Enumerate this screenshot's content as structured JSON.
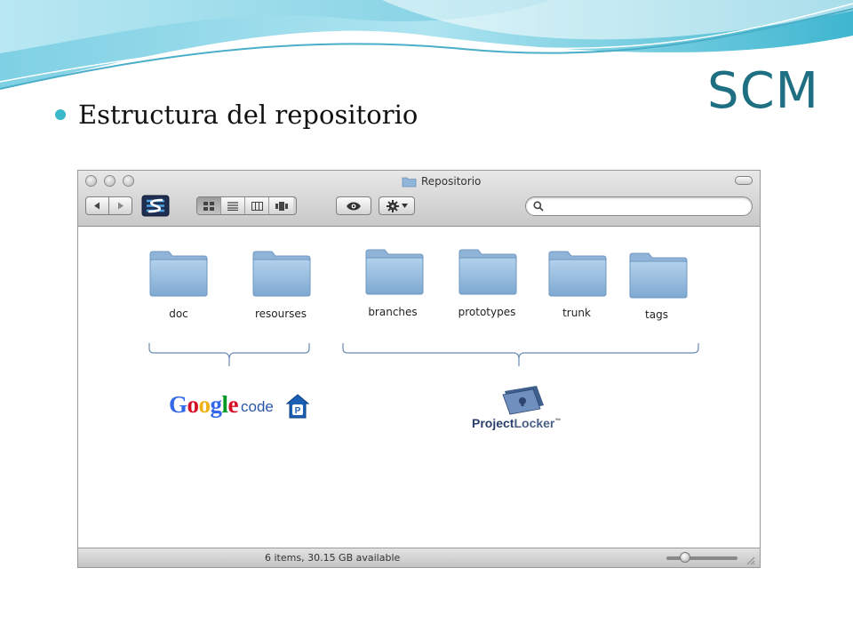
{
  "slide": {
    "title": "SCM",
    "bullet": "Estructura del repositorio",
    "accent_color": "#1f6f82"
  },
  "window": {
    "title": "Repositorio",
    "toolbar": {
      "back_icon": "back-arrow-icon",
      "forward_icon": "forward-arrow-icon",
      "view_modes": [
        "icon-view-icon",
        "list-view-icon",
        "column-view-icon",
        "coverflow-view-icon"
      ],
      "active_view": "icon-view-icon",
      "quicklook_icon": "eye-icon",
      "action_icon": "gear-icon",
      "search_placeholder": ""
    },
    "folders": [
      {
        "name": "doc"
      },
      {
        "name": "resourses"
      },
      {
        "name": "branches"
      },
      {
        "name": "prototypes"
      },
      {
        "name": "trunk"
      },
      {
        "name": "tags"
      }
    ],
    "status": "6 items, 30.15 GB available"
  },
  "logos": {
    "google_code": {
      "wordmark": "Google",
      "suffix": "code",
      "badge": "P"
    },
    "project_locker": {
      "part1": "Project",
      "part2": "Locker",
      "tm": "™"
    }
  }
}
